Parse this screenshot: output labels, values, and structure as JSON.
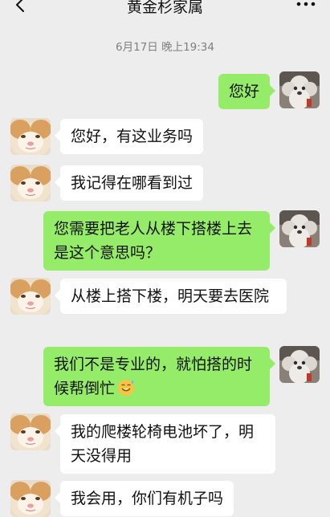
{
  "header": {
    "title": "黄金杉家属",
    "back_icon": "chevron-left-icon",
    "more_icon": "more-dots-icon"
  },
  "timestamp": "6月17日 晚上19:34",
  "messages": [
    {
      "from": "me",
      "text": "您好"
    },
    {
      "from": "contact",
      "text": "您好，有这业务吗"
    },
    {
      "from": "contact",
      "text": "我记得在哪看到过"
    },
    {
      "from": "me",
      "text": "您需要把老人从楼下搭楼上去是这个意思吗？"
    },
    {
      "from": "contact",
      "text": "从楼上搭下楼，明天要去医院"
    },
    {
      "from": "me",
      "text": "我们不是专业的，就怕搭的时候帮倒忙",
      "emoji": "sweat-smile-emoji"
    },
    {
      "from": "contact",
      "text": "我的爬楼轮椅电池坏了，明天没得用"
    },
    {
      "from": "contact",
      "text": "我会用，你们有机子吗"
    }
  ],
  "colors": {
    "background": "#ededed",
    "outgoing_bubble": "#95ec69",
    "incoming_bubble": "#ffffff",
    "timestamp_text": "#7f7f7f"
  }
}
